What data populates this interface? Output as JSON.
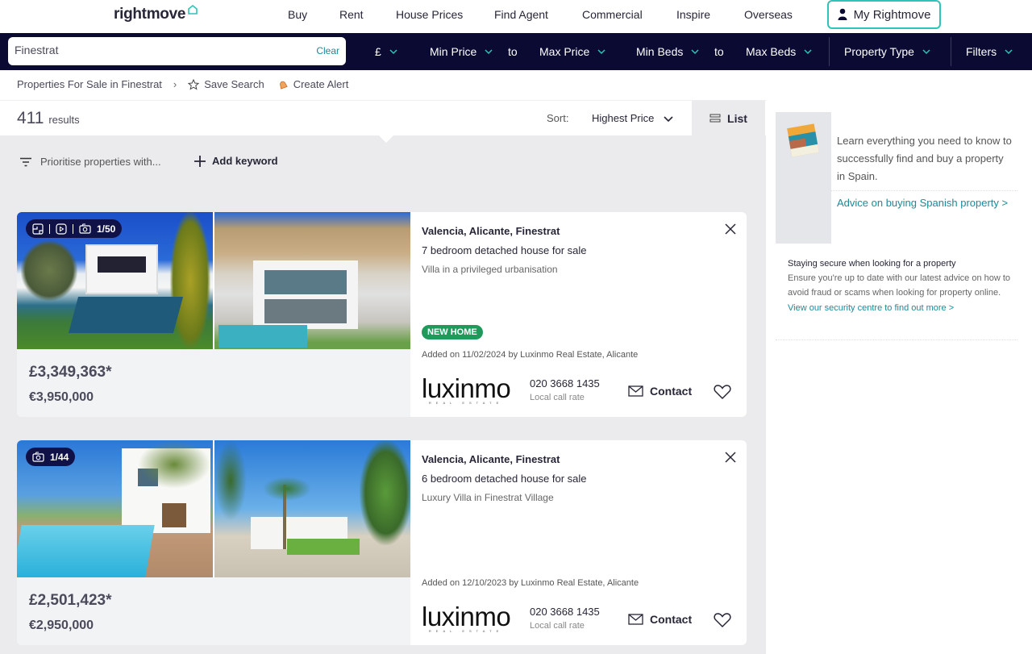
{
  "nav": {
    "logo": "rightmove",
    "links": [
      "Buy",
      "Rent",
      "House Prices",
      "Find Agent",
      "Commercial",
      "Inspire",
      "Overseas"
    ],
    "my_rightmove": "My Rightmove"
  },
  "search": {
    "location_value": "Finestrat",
    "clear_label": "Clear",
    "currency": "£",
    "min_price": "Min Price",
    "to1": "to",
    "max_price": "Max Price",
    "min_beds": "Min Beds",
    "to2": "to",
    "max_beds": "Max Beds",
    "property_type": "Property Type",
    "filters": "Filters"
  },
  "breadcrumb": {
    "path": "Properties For Sale in Finestrat",
    "save_search": "Save Search",
    "create_alert": "Create Alert"
  },
  "results": {
    "count": "411",
    "count_label": "results",
    "sort_label": "Sort:",
    "sort_value": "Highest Price",
    "view_label": "List",
    "prioritise": "Prioritise properties with...",
    "add_keyword": "Add keyword"
  },
  "listings": [
    {
      "media_badge": "1/50",
      "has_floorplan": true,
      "has_video": true,
      "price_gbp": "£3,349,363*",
      "price_eur": "€3,950,000",
      "address": "Valencia, Alicante, Finestrat",
      "type": "7 bedroom detached house for sale",
      "summary": "Villa in a privileged urbanisation",
      "tag": "NEW HOME",
      "added": "Added on 11/02/2024 by Luxinmo Real Estate, Alicante",
      "agent_logo": "luxinmo",
      "agent_logo_sub": "REAL ESTATE",
      "phone": "020 3668 1435",
      "rate": "Local call rate",
      "contact": "Contact"
    },
    {
      "media_badge": "1/44",
      "has_floorplan": false,
      "has_video": false,
      "price_gbp": "£2,501,423*",
      "price_eur": "€2,950,000",
      "address": "Valencia, Alicante, Finestrat",
      "type": "6 bedroom detached house for sale",
      "summary": "Luxury Villa in Finestrat Village",
      "tag": "",
      "added": "Added on 12/10/2023 by Luxinmo Real Estate, Alicante",
      "agent_logo": "luxinmo",
      "agent_logo_sub": "REAL ESTATE",
      "phone": "020 3668 1435",
      "rate": "Local call rate",
      "contact": "Contact"
    }
  ],
  "sidebar": {
    "guide_text": "Learn everything you need to know to successfully find and buy a property in Spain.",
    "guide_link": "Advice on buying Spanish property >",
    "security_heading": "Staying secure when looking for a property",
    "security_text": "Ensure you're up to date with our latest advice on how to avoid fraud or scams when looking for property online.",
    "security_link": "View our security centre to find out more >"
  },
  "colors": {
    "navy": "#0a0a32",
    "teal": "#2ec4b6",
    "link": "#1a8a9a",
    "new_home": "#1f9a5b"
  }
}
